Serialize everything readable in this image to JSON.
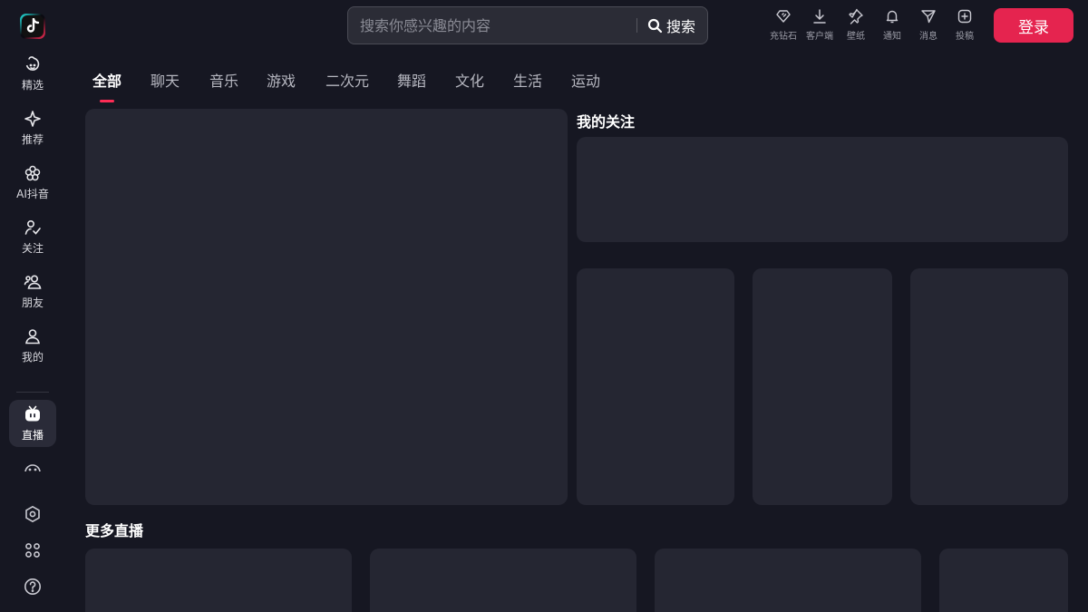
{
  "app": {
    "logo_icon": "douyin-logo-icon",
    "accent": "#fe2c55"
  },
  "sidebar": {
    "items": [
      {
        "label": "精选",
        "icon": "smile-face-icon"
      },
      {
        "label": "推荐",
        "icon": "sparkle-icon"
      },
      {
        "label": "AI抖音",
        "icon": "flower-icon"
      },
      {
        "label": "关注",
        "icon": "follow-check-icon"
      },
      {
        "label": "朋友",
        "icon": "friends-icon"
      },
      {
        "label": "我的",
        "icon": "user-icon"
      },
      {
        "label": "直播",
        "icon": "tv-icon",
        "active": true
      }
    ],
    "bottom": [
      {
        "icon": "settings-hex-icon"
      },
      {
        "icon": "apps-grid-icon"
      },
      {
        "icon": "help-icon"
      }
    ]
  },
  "search": {
    "placeholder": "搜索你感兴趣的内容",
    "button_label": "搜索"
  },
  "topbar": {
    "icons": [
      {
        "label": "充钻石",
        "icon": "diamond-icon"
      },
      {
        "label": "客户端",
        "icon": "download-icon"
      },
      {
        "label": "壁纸",
        "icon": "pin-icon"
      },
      {
        "label": "通知",
        "icon": "bell-icon"
      },
      {
        "label": "消息",
        "icon": "send-icon"
      },
      {
        "label": "投稿",
        "icon": "upload-plus-icon"
      }
    ],
    "login_label": "登录",
    "login_color": "#e5244f"
  },
  "tabs": [
    {
      "label": "全部",
      "active": true
    },
    {
      "label": "聊天"
    },
    {
      "label": "音乐"
    },
    {
      "label": "游戏"
    },
    {
      "label": "二次元"
    },
    {
      "label": "舞蹈"
    },
    {
      "label": "文化"
    },
    {
      "label": "生活"
    },
    {
      "label": "运动"
    }
  ],
  "sections": {
    "following_title": "我的关注",
    "more_live_title": "更多直播"
  }
}
